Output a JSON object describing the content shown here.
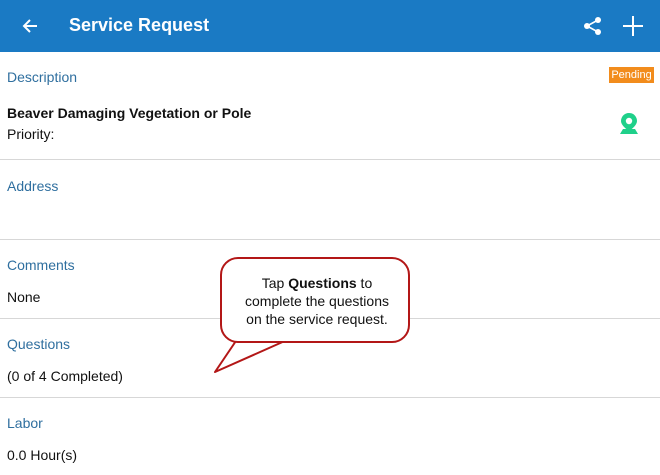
{
  "header": {
    "title": "Service Request",
    "back_icon": "arrow-left-icon",
    "share_icon": "share-icon",
    "add_icon": "plus-icon",
    "bg_color": "#1a7ac4"
  },
  "description": {
    "label": "Description",
    "status": "Pending",
    "title": "Beaver Damaging Vegetation or Pole",
    "priority": "Priority:",
    "map_icon": "map-pin-icon",
    "status_color": "#f28c1c"
  },
  "address": {
    "label": "Address"
  },
  "comments": {
    "label": "Comments",
    "value": "None"
  },
  "questions": {
    "label": "Questions",
    "value": "(0 of 4 Completed)"
  },
  "labor": {
    "label": "Labor",
    "value": "0.0 Hour(s)"
  },
  "callout": {
    "prefix": "Tap ",
    "emphasis": "Questions",
    "suffix": " to",
    "line2": "complete the questions",
    "line3": "on the service request."
  }
}
